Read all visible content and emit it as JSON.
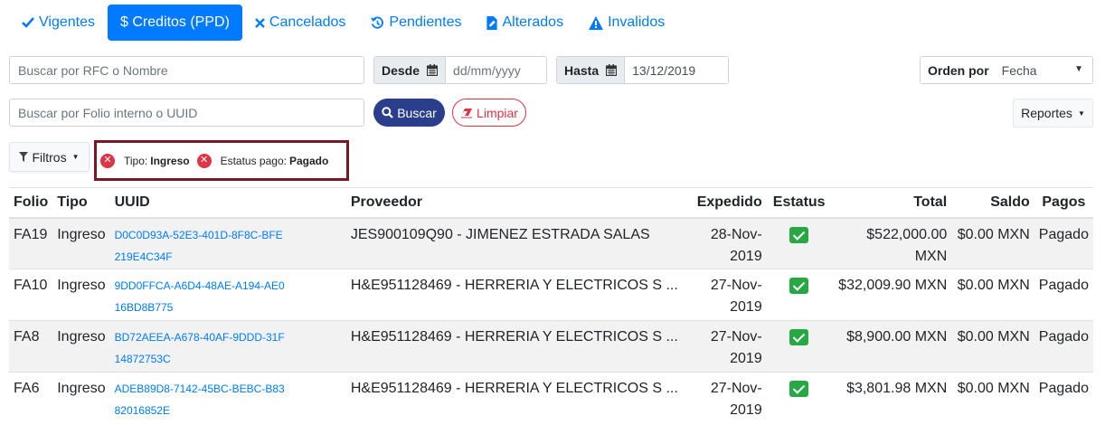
{
  "tabs": [
    {
      "label": "Vigentes",
      "icon": "check-icon",
      "active": false
    },
    {
      "label": "$ Creditos (PPD)",
      "icon": "",
      "active": true
    },
    {
      "label": "Cancelados",
      "icon": "times-icon",
      "active": false
    },
    {
      "label": "Pendientes",
      "icon": "history-icon",
      "active": false
    },
    {
      "label": "Alterados",
      "icon": "file-edit-icon",
      "active": false
    },
    {
      "label": "Invalidos",
      "icon": "warning-icon",
      "active": false
    }
  ],
  "search": {
    "rfc_placeholder": "Buscar por RFC o Nombre",
    "folio_placeholder": "Buscar por Folio interno o UUID"
  },
  "dates": {
    "desde_label": "Desde",
    "desde_placeholder": "dd/mm/yyyy",
    "hasta_label": "Hasta",
    "hasta_value": "13/12/2019"
  },
  "order": {
    "label": "Orden por",
    "value": "Fecha"
  },
  "buttons": {
    "buscar": "Buscar",
    "limpiar": "Limpiar",
    "reportes": "Reportes",
    "filtros": "Filtros"
  },
  "active_filters": [
    {
      "label": "Tipo:",
      "value": "Ingreso"
    },
    {
      "label": "Estatus pago:",
      "value": "Pagado"
    }
  ],
  "table": {
    "headers": [
      "Folio",
      "Tipo",
      "UUID",
      "Proveedor",
      "Expedido",
      "Estatus",
      "Total",
      "Saldo",
      "Pagos"
    ],
    "rows": [
      {
        "folio": "FA19",
        "tipo": "Ingreso",
        "uuid": "D0C0D93A-52E3-401D-8F8C-BFE219E4C34F",
        "proveedor": "JES900109Q90 - JIMENEZ ESTRADA SALAS",
        "expedido": "28-Nov-2019",
        "estatus": "ok",
        "total": "$522,000.00 MXN",
        "saldo": "$0.00 MXN",
        "pagos": "Pagado"
      },
      {
        "folio": "FA10",
        "tipo": "Ingreso",
        "uuid": "9DD0FFCA-A6D4-48AE-A194-AE016BD8B775",
        "proveedor": "H&E951128469 - HERRERIA Y ELECTRICOS S ...",
        "expedido": "27-Nov-2019",
        "estatus": "ok",
        "total": "$32,009.90 MXN",
        "saldo": "$0.00 MXN",
        "pagos": "Pagado"
      },
      {
        "folio": "FA8",
        "tipo": "Ingreso",
        "uuid": "BD72AEEA-A678-40AF-9DDD-31F14872753C",
        "proveedor": "H&E951128469 - HERRERIA Y ELECTRICOS S ...",
        "expedido": "27-Nov-2019",
        "estatus": "ok",
        "total": "$8,900.00 MXN",
        "saldo": "$0.00 MXN",
        "pagos": "Pagado"
      },
      {
        "folio": "FA6",
        "tipo": "Ingreso",
        "uuid": "ADEB89D8-7142-45BC-BEBC-B8382016852E",
        "proveedor": "H&E951128469 - HERRERIA Y ELECTRICOS S ...",
        "expedido": "27-Nov-2019",
        "estatus": "ok",
        "total": "$3,801.98 MXN",
        "saldo": "$0.00 MXN",
        "pagos": "Pagado"
      }
    ]
  },
  "colors": {
    "primary": "#007bff",
    "buscar": "#2a3e8c",
    "danger": "#dc3545",
    "success": "#28a745",
    "filter_border": "#7a1627"
  }
}
